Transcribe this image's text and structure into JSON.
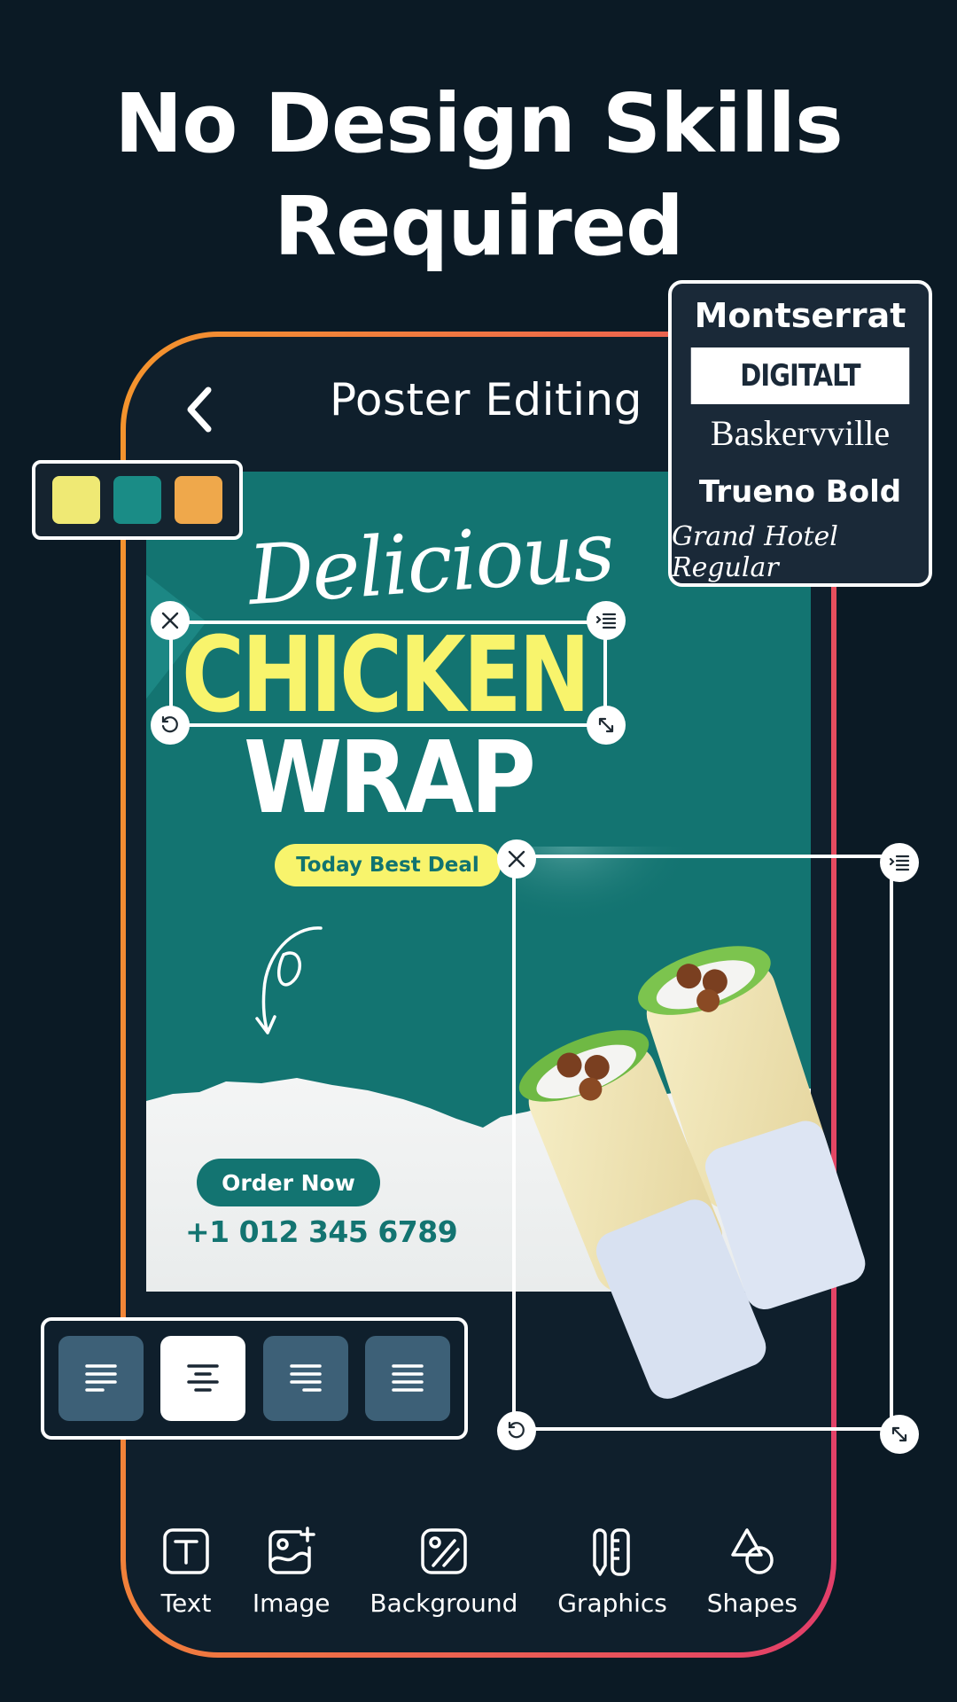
{
  "headline": {
    "line1": "No Design Skills",
    "line2": "Required"
  },
  "app": {
    "title": "Poster Editing",
    "back_icon": "chevron-left-icon"
  },
  "palette": {
    "colors": [
      "#efe974",
      "#1a8c86",
      "#efa84b"
    ]
  },
  "font_panel": {
    "fonts": [
      {
        "label": "Montserrat",
        "selected": false
      },
      {
        "label": "DIGITALT",
        "selected": true
      },
      {
        "label": "Baskervville",
        "selected": false
      },
      {
        "label": "Trueno Bold",
        "selected": false
      },
      {
        "label": "Grand Hotel Regular",
        "selected": false
      }
    ]
  },
  "poster": {
    "script_text": "Delicious",
    "headline_text": "CHICKEN",
    "subheadline_text": "WRAP",
    "deal_badge": "Today Best Deal",
    "cta": "Order Now",
    "phone": "+1 012 345 6789",
    "colors": {
      "teal": "#137471",
      "yellow": "#f8f46c",
      "white": "#ffffff"
    }
  },
  "selection_handles": {
    "close_icon": "close-icon",
    "menu_icon": "indent-menu-icon",
    "rotate_icon": "rotate-icon",
    "resize_icon": "resize-diagonal-icon"
  },
  "align_panel": {
    "options": [
      {
        "name": "align-left",
        "active": false
      },
      {
        "name": "align-center",
        "active": true
      },
      {
        "name": "align-right",
        "active": false
      },
      {
        "name": "align-justify",
        "active": false
      }
    ]
  },
  "toolbar": {
    "items": [
      {
        "label": "Text",
        "icon": "text-box-icon"
      },
      {
        "label": "Image",
        "icon": "image-add-icon"
      },
      {
        "label": "Background",
        "icon": "background-icon"
      },
      {
        "label": "Graphics",
        "icon": "graphics-icon"
      },
      {
        "label": "Shapes",
        "icon": "shapes-icon"
      }
    ]
  },
  "theme": {
    "background": "#0b1a25",
    "frame_gradient_start": "#f4952c",
    "frame_gradient_end": "#e23d6a",
    "align_inactive": "#3d6077"
  }
}
